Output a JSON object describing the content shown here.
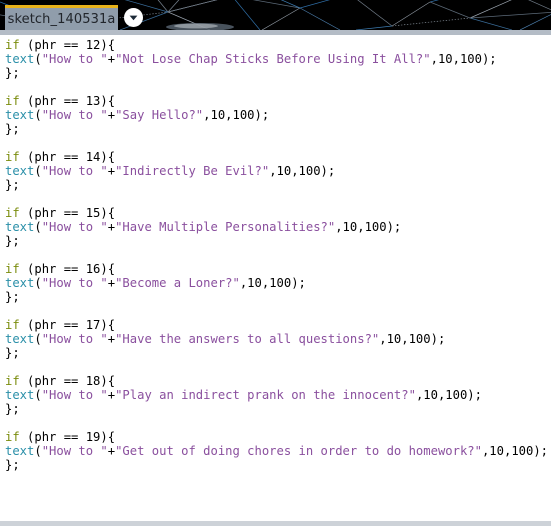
{
  "window": {
    "app": "Processing Development Environment",
    "banner_style": "dark triangulated network graphic"
  },
  "tab": {
    "name": "sketch_140531a",
    "menu_icon": "chevron-down-icon",
    "accent_color": "#e8b21a",
    "background_color": "#909dab"
  },
  "editor": {
    "language": "Processing / Java",
    "colors": {
      "keyword": "#7a8c0c",
      "function": "#2a8fa8",
      "string": "#8a4f9e",
      "plain": "#000000",
      "background": "#ffffff"
    },
    "common": {
      "prefix": "text(\"How to \"+\"",
      "suffix": "\",10,100);",
      "close": "};",
      "if_open": "if (phr == ",
      "if_close": "){"
    },
    "blocks": [
      {
        "condition": "12",
        "phrase": "Not Lose Chap Sticks Before Using It All?"
      },
      {
        "condition": "13",
        "phrase": "Say Hello?"
      },
      {
        "condition": "14",
        "phrase": "Indirectly Be Evil?"
      },
      {
        "condition": "15",
        "phrase": "Have Multiple Personalities?"
      },
      {
        "condition": "16",
        "phrase": "Become a Loner?"
      },
      {
        "condition": "17",
        "phrase": "Have the answers to all questions?"
      },
      {
        "condition": "18",
        "phrase": "Play an indirect prank on the innocent?"
      },
      {
        "condition": "19",
        "phrase": "Get out of doing chores in order to do homework?"
      }
    ]
  }
}
